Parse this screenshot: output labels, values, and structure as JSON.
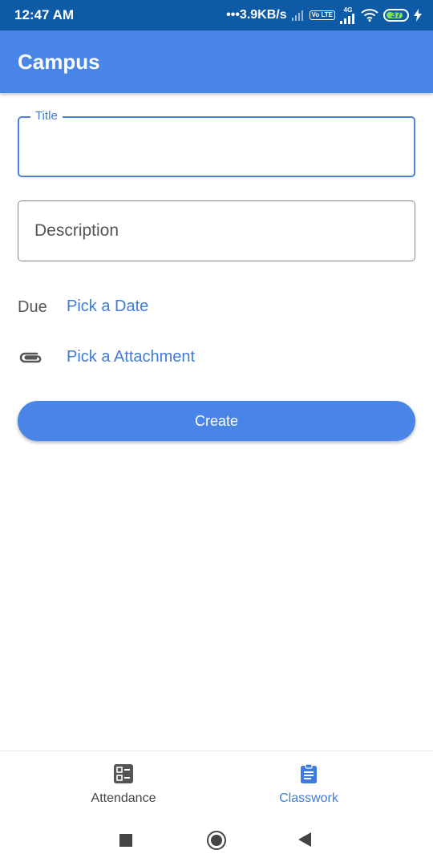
{
  "status_bar": {
    "time": "12:47 AM",
    "speed": "3.9KB/s",
    "volte_label": "Vo LTE",
    "network_label": "4G",
    "battery": "37"
  },
  "app_bar": {
    "title": "Campus"
  },
  "form": {
    "title_label": "Title",
    "title_value": "",
    "description_placeholder": "Description",
    "due_label": "Due",
    "pick_date_label": "Pick a Date",
    "pick_attachment_label": "Pick a Attachment",
    "create_label": "Create"
  },
  "bottom_nav": {
    "items": [
      {
        "label": "Attendance",
        "icon": "attendance-icon",
        "active": false
      },
      {
        "label": "Classwork",
        "icon": "clipboard-icon",
        "active": true
      }
    ]
  },
  "colors": {
    "primary": "#4985e6",
    "status_bar": "#0d5aa6",
    "accent_text": "#3f7bd8"
  }
}
